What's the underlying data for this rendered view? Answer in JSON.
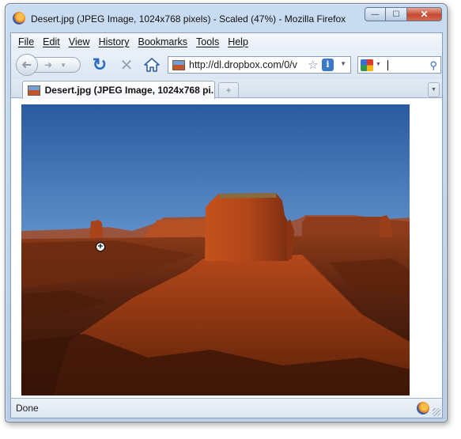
{
  "window": {
    "title": "Desert.jpg (JPEG Image, 1024x768 pixels) - Scaled (47%) - Mozilla Firefox",
    "controls": {
      "minimize": "—",
      "maximize": "☐",
      "close": "✕"
    }
  },
  "menubar": {
    "items": [
      "File",
      "Edit",
      "View",
      "History",
      "Bookmarks",
      "Tools",
      "Help"
    ]
  },
  "navbar": {
    "back_icon": "back-arrow-icon",
    "forward_icon": "forward-arrow-icon",
    "url": "http://dl.dropbox.com/0/v",
    "search_value": ""
  },
  "tabs": {
    "active_title": "Desert.jpg (JPEG Image, 1024x768 pi...",
    "new_tab": "+"
  },
  "content": {
    "image_description_icon": "desert-photo",
    "cursor_icon": "zoom-in-cursor-icon"
  },
  "statusbar": {
    "text": "Done"
  },
  "colors": {
    "sky_top": "#2f5fa0",
    "sky_bottom": "#9dbde0",
    "rock": "#b84a1c",
    "accent": "#2b6cc4"
  }
}
